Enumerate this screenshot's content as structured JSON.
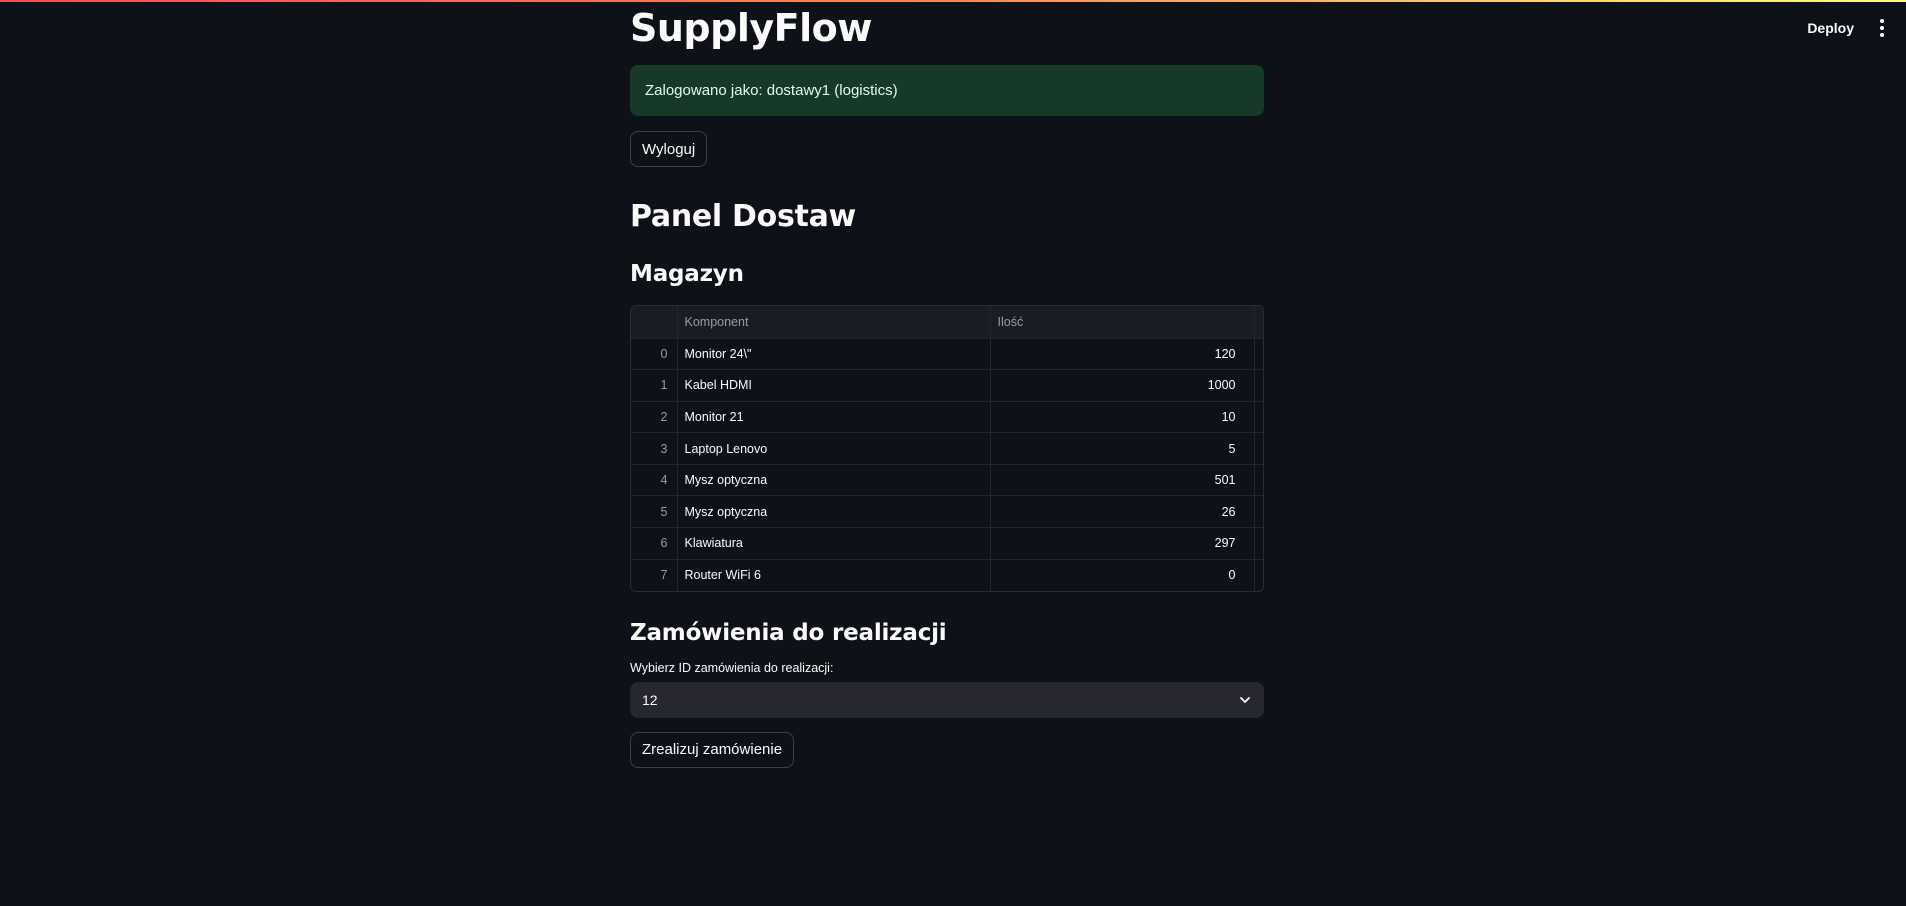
{
  "header": {
    "deploy_label": "Deploy",
    "menu_icon": "kebab-menu-icon"
  },
  "app": {
    "title": "SupplyFlow"
  },
  "alert": {
    "text": "Zalogowano jako: dostawy1 (logistics)",
    "color": "#173928"
  },
  "logout_label": "Wyloguj",
  "panel_title": "Panel Dostaw",
  "warehouse": {
    "title": "Magazyn",
    "columns": [
      "Komponent",
      "Ilość"
    ],
    "rows": [
      {
        "idx": "0",
        "name": "Monitor 24\\\"",
        "qty": "120"
      },
      {
        "idx": "1",
        "name": "Kabel HDMI",
        "qty": "1000"
      },
      {
        "idx": "2",
        "name": "Monitor 21",
        "qty": "10"
      },
      {
        "idx": "3",
        "name": "Laptop Lenovo",
        "qty": "5"
      },
      {
        "idx": "4",
        "name": "Mysz optyczna",
        "qty": "501"
      },
      {
        "idx": "5",
        "name": "Mysz optyczna",
        "qty": "26"
      },
      {
        "idx": "6",
        "name": "Klawiatura",
        "qty": "297"
      },
      {
        "idx": "7",
        "name": "Router WiFi 6",
        "qty": "0"
      }
    ]
  },
  "orders": {
    "title": "Zamówienia do realizacji",
    "select_label": "Wybierz ID zamówienia do realizacji:",
    "selected_value": "12",
    "submit_label": "Zrealizuj zamówienie"
  }
}
